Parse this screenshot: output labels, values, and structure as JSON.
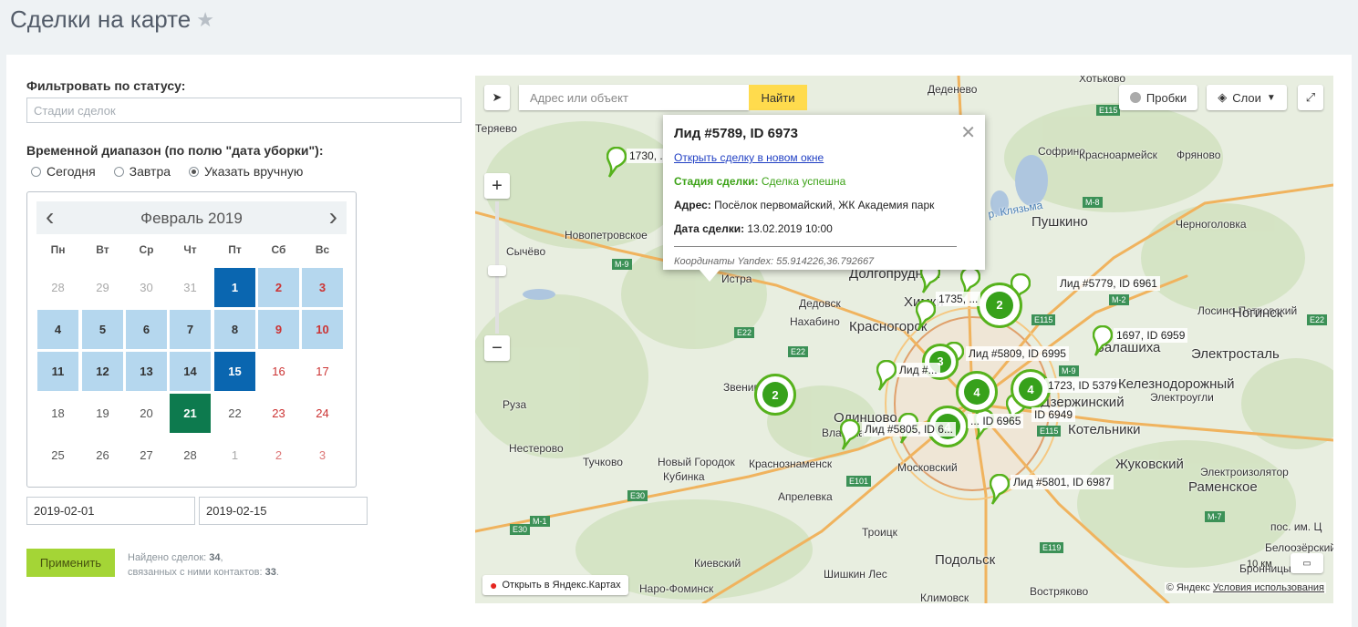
{
  "page": {
    "title": "Сделки на карте"
  },
  "filter": {
    "status_label": "Фильтровать по статусу:",
    "status_placeholder": "Стадии сделок",
    "range_label": "Временной диапазон (по полю \"дата уборки\"):",
    "radios": [
      {
        "label": "Сегодня",
        "checked": false
      },
      {
        "label": "Завтра",
        "checked": false
      },
      {
        "label": "Указать вручную",
        "checked": true
      }
    ]
  },
  "calendar": {
    "month": "Февраль 2019",
    "weekdays": [
      "Пн",
      "Вт",
      "Ср",
      "Чт",
      "Пт",
      "Сб",
      "Вс"
    ],
    "weeks": [
      [
        "28",
        "29",
        "30",
        "31",
        "1",
        "2",
        "3"
      ],
      [
        "4",
        "5",
        "6",
        "7",
        "8",
        "9",
        "10"
      ],
      [
        "11",
        "12",
        "13",
        "14",
        "15",
        "16",
        "17"
      ],
      [
        "18",
        "19",
        "20",
        "21",
        "22",
        "23",
        "24"
      ],
      [
        "25",
        "26",
        "27",
        "28",
        "1",
        "2",
        "3"
      ]
    ],
    "range_from": "2019-02-01",
    "range_to": "2019-02-15",
    "today": "2019-02-21"
  },
  "actions": {
    "apply_label": "Применить",
    "found_prefix": "Найдено сделок:",
    "found_count": "34",
    "found_suffix": ",",
    "contacts_prefix": "связанных с ними контактов:",
    "contacts_count": "33",
    "contacts_suffix": "."
  },
  "map": {
    "search_placeholder": "Адрес или объект",
    "find_label": "Найти",
    "traffic_label": "Пробки",
    "layers_label": "Слои",
    "open_yandex_label": "Открыть в Яндекс.Картах",
    "copyright": "© Яндекс",
    "terms": "Условия использования",
    "scale": "10 км",
    "zoom_in": "+",
    "zoom_out": "−",
    "balloon": {
      "title": "Лид #5789, ID 6973",
      "link": "Открыть сделку в новом окне",
      "stage_label": "Стадия сделки:",
      "stage_value": "Сделка успешна",
      "address_label": "Адрес:",
      "address_value": "Посёлок первомайский, ЖК Академия парк",
      "date_label": "Дата сделки:",
      "date_value": "13.02.2019 10:00",
      "coords": "Координаты Yandex: 55.914226,36.792667"
    },
    "places": [
      "Деденево",
      "Хотьково",
      "Теряево",
      "Софрино",
      "Красноармейск",
      "Фряново",
      "Пушкино",
      "Черноголовка",
      "Сычёво",
      "Новопетровское",
      "Истра",
      "Дедовск",
      "Нахабино",
      "Красногорск",
      "Лосино-Петровский",
      "Ногинск",
      "Электросталь",
      "Руза",
      "Звенигород",
      "Электроугли",
      "Нестерово",
      "Тучково",
      "Новый Городок",
      "Кубинка",
      "Краснознаменск",
      "Московский",
      "Жуковский",
      "Электроизолятор",
      "Раменское",
      "Апрелевка",
      "Троицк",
      "пос. им. Ц",
      "Киевский",
      "Шишкин Лес",
      "Подольск",
      "Бронницы",
      "Белоозёрский",
      "Наро-Фоминск",
      "Климовск",
      "Востряково",
      "Долгопрудный",
      "Одинцово",
      "Дзержинский",
      "Котельники",
      "Балашиха",
      "р. Клязьма",
      "Железнодорожный",
      "Химки",
      "Власиха"
    ],
    "roads": [
      "Е115",
      "М-8",
      "E22",
      "М-9",
      "E22",
      "E22",
      "E115",
      "М-9",
      "E101",
      "E30",
      "М-1",
      "E30",
      "E119",
      "E115",
      "M-7",
      "M-2"
    ],
    "clusters": [
      "2",
      "2",
      "4",
      "4",
      "3",
      "4"
    ],
    "pin_labels": [
      "1730, ...",
      "Лид #5779, ID 6961",
      "1735, ...",
      "1697, ID 6959",
      "Лид #5809, ID 6995",
      "Лид #...",
      "1723, ID 5379",
      "ID 6949",
      "Лид #5805, ID 6...",
      "... ID 6965",
      "Лид #5801, ID 6987"
    ]
  }
}
